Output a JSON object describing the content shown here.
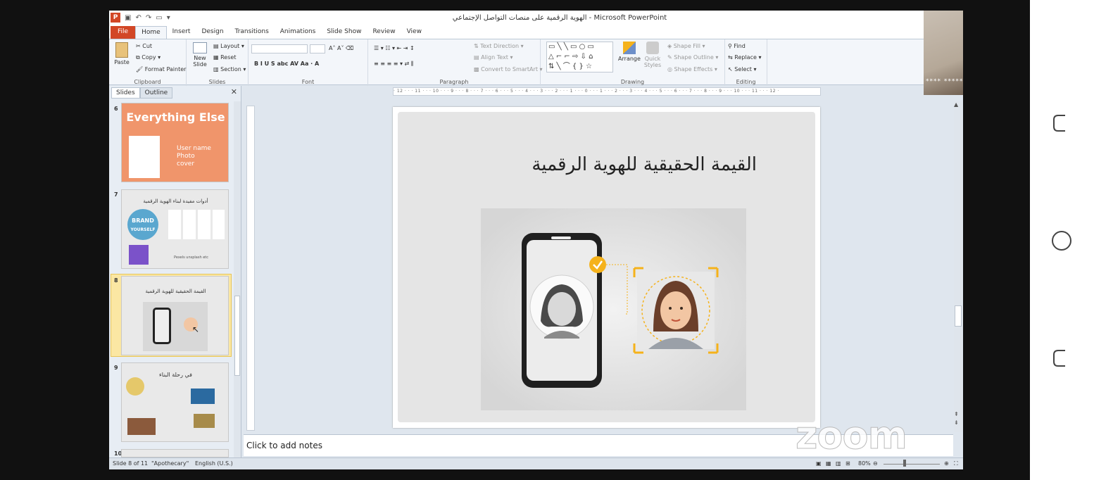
{
  "window": {
    "title": "الهوية الرقمية على منصات التواصل الإجتماعي - Microsoft PowerPoint"
  },
  "ribbon_tabs": [
    "File",
    "Home",
    "Insert",
    "Design",
    "Transitions",
    "Animations",
    "Slide Show",
    "Review",
    "View"
  ],
  "ribbon": {
    "clipboard": {
      "paste": "Paste",
      "cut": "Cut",
      "copy": "Copy",
      "format_painter": "Format Painter",
      "label": "Clipboard"
    },
    "slides": {
      "new_slide": "New Slide",
      "layout": "Layout",
      "reset": "Reset",
      "section": "Section",
      "label": "Slides"
    },
    "font": {
      "label": "Font"
    },
    "paragraph": {
      "text_direction": "Text Direction",
      "align_text": "Align Text",
      "convert_smartart": "Convert to SmartArt",
      "label": "Paragraph"
    },
    "drawing": {
      "arrange": "Arrange",
      "quick_styles": "Quick Styles",
      "shape_fill": "Shape Fill",
      "shape_outline": "Shape Outline",
      "shape_effects": "Shape Effects",
      "label": "Drawing"
    },
    "editing": {
      "find": "Find",
      "replace": "Replace",
      "select": "Select",
      "label": "Editing"
    }
  },
  "pane": {
    "tabs": [
      "Slides",
      "Outline"
    ],
    "thumbnails": [
      {
        "number": "6",
        "title": "Everything Else",
        "lines": [
          "User name",
          "Photo",
          "cover"
        ]
      },
      {
        "number": "7",
        "title": "أدوات مفيدة لبناء الهوية الرقمية",
        "brand_line1": "BRAND",
        "brand_line2": "YOURSELF",
        "caption": "Pexels  unsplash  etc"
      },
      {
        "number": "8",
        "title": "القيمة الحقيقية للهوية الرقمية"
      },
      {
        "number": "9",
        "title": "في رحلة البناء"
      },
      {
        "number": "10"
      }
    ]
  },
  "ruler_text": "· 12 · · · 11 · · · 10 · · · 9 · · · 8 · · · 7 · · · 6 · · · 5 · · · 4 · · · 3 · · · 2 · · · 1 · · · 0 · · · 1 · · · 2 · · · 3 · · · 4 · · · 5 · · · 6 · · · 7 · · · 8 · · · 9 · · · 10 · · · 11 · · · 12 ·",
  "slide": {
    "title": "القيمة الحقيقية للهوية الرقمية"
  },
  "notes_placeholder": "Click to add notes",
  "status": {
    "slide_info": "Slide 8 of 11",
    "theme": "\"Apothecary\"",
    "language": "English (U.S.)",
    "zoom": "80%"
  },
  "video": {
    "participant_name": "**** *****"
  },
  "watermark": "zoom",
  "colors": {
    "ppt_orange": "#d24726",
    "selection": "#fbe7a3",
    "slide6_bg": "#f0956b",
    "badge": "#f5b21b"
  }
}
